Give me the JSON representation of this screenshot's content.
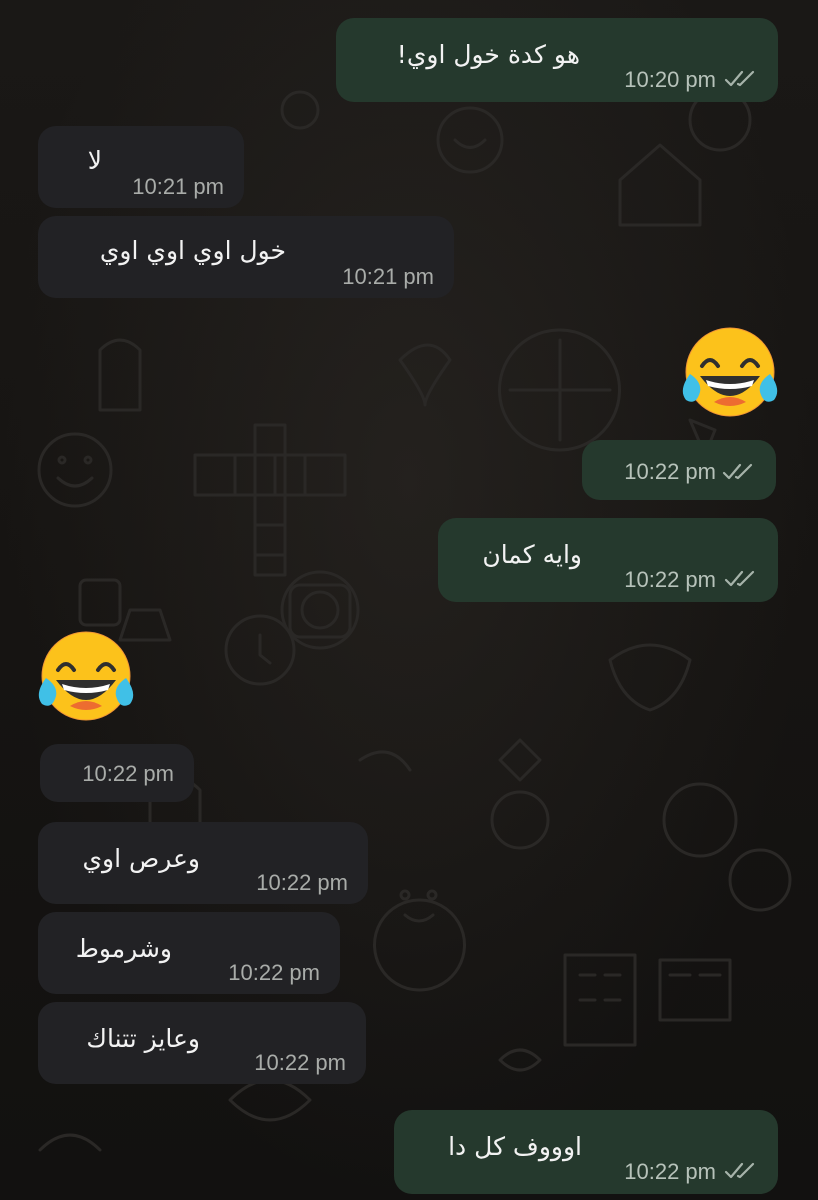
{
  "colors": {
    "outgoing_bubble": "#25392d",
    "incoming_bubble": "#222225",
    "read_ticks": "#a6b3aa",
    "background": "#141210"
  },
  "messages": [
    {
      "dir": "out",
      "text": "هو كدة خول اوي!",
      "time": "10:20 pm",
      "status_icon": "double-check-icon"
    },
    {
      "dir": "in",
      "text": "لا",
      "time": "10:21 pm"
    },
    {
      "dir": "in",
      "text": "خول اوي اوي اوي",
      "time": "10:21 pm"
    },
    {
      "dir": "out",
      "emoji": "face-with-tears-of-joy-emoji",
      "time": "10:22 pm",
      "status_icon": "double-check-icon"
    },
    {
      "dir": "out",
      "text": "وايه كمان",
      "time": "10:22 pm",
      "status_icon": "double-check-icon"
    },
    {
      "dir": "in",
      "emoji": "face-with-tears-of-joy-emoji",
      "time": "10:22 pm"
    },
    {
      "dir": "in",
      "text": "وعرص اوي",
      "time": "10:22 pm"
    },
    {
      "dir": "in",
      "text": "وشرموط",
      "time": "10:22 pm"
    },
    {
      "dir": "in",
      "text": "وعايز تتناك",
      "time": "10:22 pm"
    },
    {
      "dir": "out",
      "text": "اوووف كل دا",
      "time": "10:22 pm",
      "status_icon": "double-check-icon"
    }
  ]
}
